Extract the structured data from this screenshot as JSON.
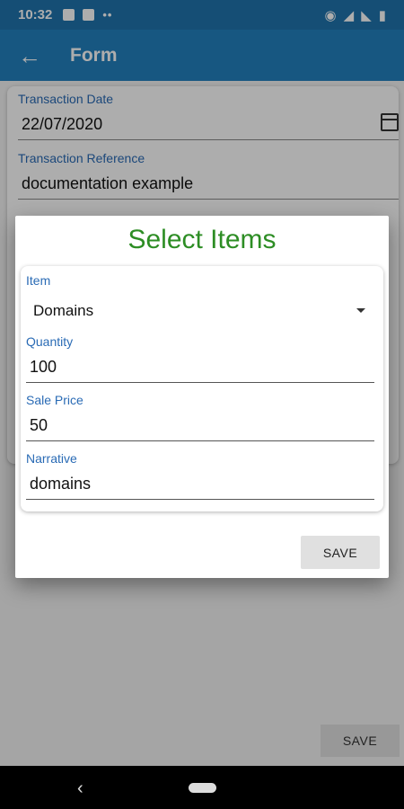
{
  "status_bar": {
    "time": "10:32",
    "calendar_day": "31",
    "notif_dots": "••"
  },
  "app_bar": {
    "back_icon": "arrow-left-icon",
    "title": "Form"
  },
  "background_form": {
    "fields": [
      {
        "label": "Transaction Date",
        "value": "22/07/2020"
      },
      {
        "label": "Transaction Reference",
        "value": "documentation example"
      }
    ],
    "save_label": "SAVE"
  },
  "dialog": {
    "title": "Select Items",
    "title_color": "#2d8d24",
    "item": {
      "label": "Item",
      "value": "Domains"
    },
    "quantity": {
      "label": "Quantity",
      "value": "100"
    },
    "sale_price": {
      "label": "Sale Price",
      "value": "50"
    },
    "narrative": {
      "label": "Narrative",
      "value": "domains"
    },
    "save_label": "SAVE"
  },
  "colors": {
    "app_bar": "#2380bf",
    "status_bar": "#1f74ad",
    "label": "#2a6bb5"
  }
}
